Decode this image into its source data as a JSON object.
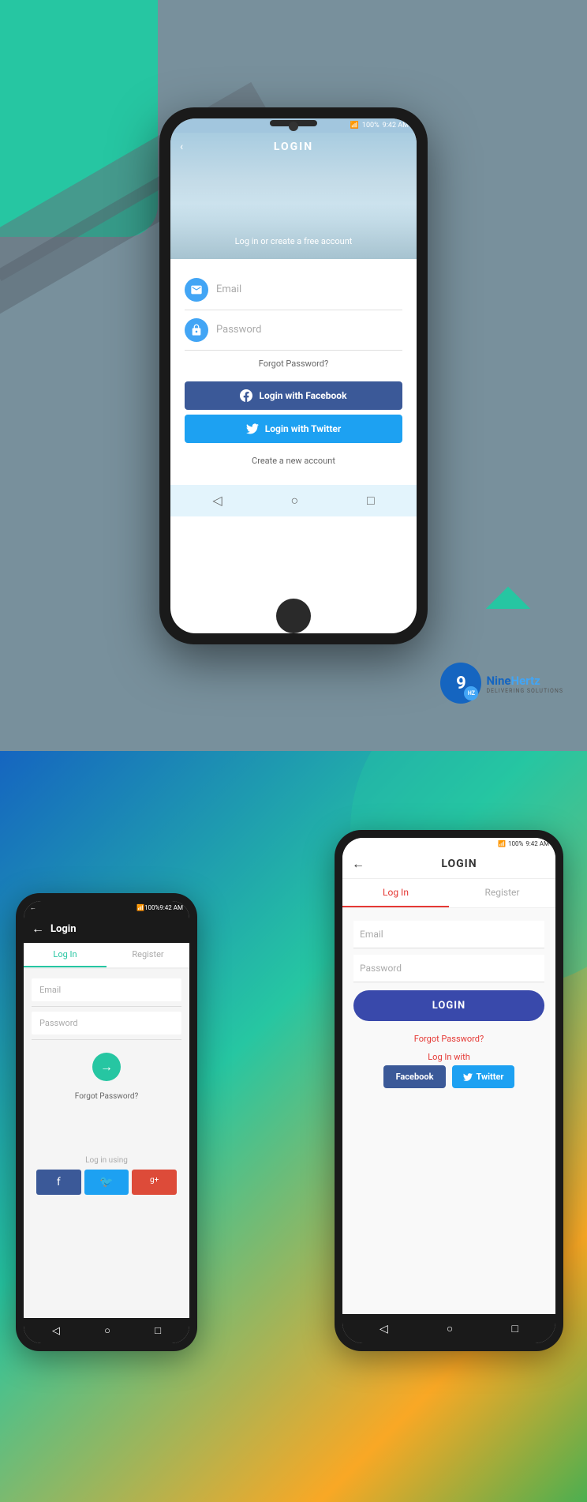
{
  "top": {
    "bg_color": "#78909c",
    "phone": {
      "status_bar": {
        "time": "9:42 AM",
        "battery": "100%",
        "signal": "wifi + bars"
      },
      "header": {
        "title": "LOGIN",
        "back_icon": "‹",
        "tagline": "Log in or create a free account"
      },
      "form": {
        "email_placeholder": "Email",
        "password_placeholder": "Password",
        "forgot_password": "Forgot Password?",
        "facebook_button": "Login with Facebook",
        "twitter_button": "Login with Twitter",
        "create_account": "Create a new account"
      },
      "nav": {
        "back": "◁",
        "home": "○",
        "recent": "□"
      }
    },
    "logo": {
      "number": "9",
      "name_part1": "Nine",
      "name_part2": "Hertz",
      "subtitle": "DELIVERING SOLUTIONS",
      "hz": "HZ"
    }
  },
  "bottom": {
    "left_phone": {
      "status_bar": {
        "time": "9:42 AM",
        "battery": "100%"
      },
      "header": {
        "back_icon": "←",
        "title": "Login"
      },
      "tabs": {
        "login": "Log In",
        "register": "Register"
      },
      "form": {
        "email_placeholder": "Email",
        "password_placeholder": "Password",
        "forgot_password": "Forgot Password?",
        "login_using": "Log in using"
      },
      "social_icons": {
        "facebook": "f",
        "twitter": "🐦",
        "google": "g+"
      },
      "nav": {
        "back": "◁",
        "home": "○",
        "recent": "□"
      }
    },
    "right_phone": {
      "status_bar": {
        "time": "9:42 AM",
        "battery": "100%"
      },
      "header": {
        "back_icon": "←",
        "title": "LOGIN"
      },
      "tabs": {
        "login": "Log In",
        "register": "Register"
      },
      "form": {
        "email_placeholder": "Email",
        "password_placeholder": "Password",
        "login_button": "LOGIN",
        "forgot_password": "Forgot Password?",
        "login_with": "Log In with",
        "facebook_button": "Facebook",
        "twitter_button": "Twitter"
      },
      "nav": {
        "back": "◁",
        "home": "○",
        "recent": "□"
      }
    }
  }
}
